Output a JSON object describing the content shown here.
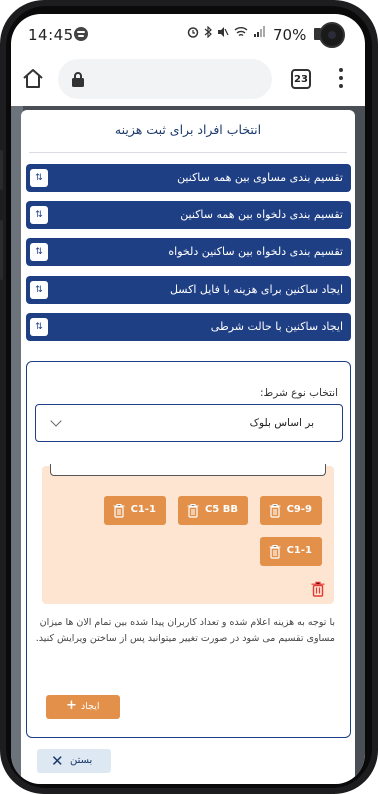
{
  "status": {
    "time": "14:45",
    "battery": "70%",
    "icons": [
      "alarm-icon",
      "bluetooth-icon",
      "mute-icon",
      "wifi-icon",
      "signal-icon"
    ]
  },
  "browser": {
    "tab_count": "23"
  },
  "modal": {
    "title": "انتخاب افراد برای ثبت هزینه",
    "options": [
      {
        "label": "تقسیم بندی مساوی بین همه ساکنین"
      },
      {
        "label": "تقسیم بندی دلخواه بین همه ساکنین"
      },
      {
        "label": "تقسیم بندی دلخواه بین ساکنین دلخواه"
      },
      {
        "label": "ایجاد ساکنین برای هزینه با فایل اکسل"
      },
      {
        "label": "ایجاد ساکنین با حالت شرطی"
      }
    ],
    "toggle_glyph": "⇅",
    "condition": {
      "label": "انتخاب نوع شرط:",
      "selected": "بر اساس بلوک"
    },
    "chips": [
      "C9-9",
      "C5 BB",
      "C1-1",
      "C1-1"
    ],
    "note": "با توجه به هزینه اعلام شده و تعداد کاربران پیدا شده بین تمام الان ها میزان مساوی تقسیم می شود در صورت تغییر میتوانید پس از ساختن ویرایش کنید.",
    "create_label": "ایجاد",
    "close_label": "بستن"
  },
  "colors": {
    "primary": "#1f3f85",
    "accent": "#e2904a",
    "peach": "#fde5d2",
    "danger": "#e53935"
  }
}
